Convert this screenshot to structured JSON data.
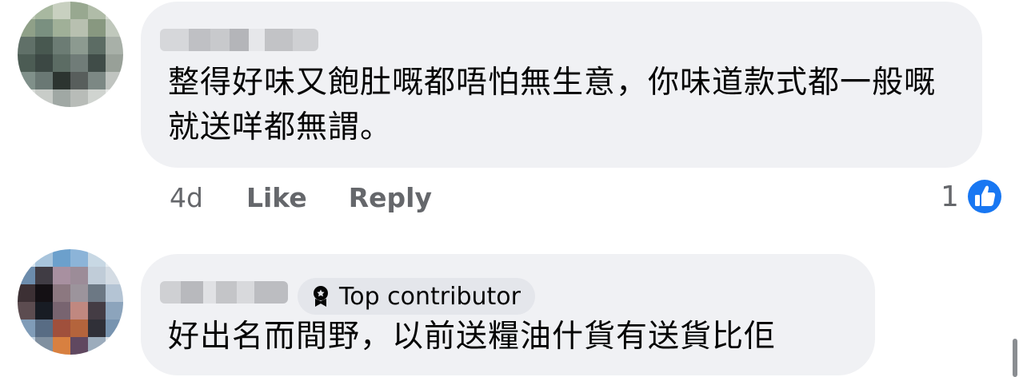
{
  "comments": [
    {
      "text": "整得好味又飽肚嘅都唔怕無生意，你味道款式都一般嘅就送咩都無謂。",
      "time": "4d",
      "like_label": "Like",
      "reply_label": "Reply",
      "reaction_count": "1"
    },
    {
      "badge_label": "Top contributor",
      "text": "好出名而間野，以前送糧油什貨有送貨比佢"
    }
  ],
  "colors": {
    "bubble": "#f0f1f4",
    "like_blue": "#1877f2",
    "secondary_text": "#65676b"
  }
}
